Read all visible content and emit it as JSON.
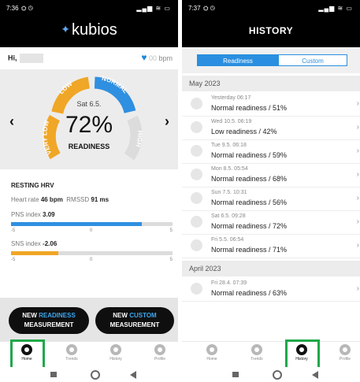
{
  "left": {
    "status_time": "7:36",
    "status_left_icons": "⛭ ◷",
    "status_right_icons": "▂▄▆ ≋ ▭",
    "app_name": "kubios",
    "greeting": "Hi,",
    "heart_rate_value": "00",
    "heart_rate_unit": "bpm",
    "gauge": {
      "date": "Sat 6.5.",
      "percent": "72%",
      "label": "READINESS",
      "readiness_value_percent": 72,
      "zones": [
        "VERY LOW",
        "LOW",
        "NORMAL",
        "HIGH"
      ],
      "zone_colors": [
        "#f0a626",
        "#f0a626",
        "#2f8fe0",
        "#dcdcdc"
      ],
      "prev_arrow": "‹",
      "next_arrow": "›"
    },
    "hrv": {
      "title": "RESTING HRV",
      "heart_rate_label": "Heart rate",
      "heart_rate": "46 bpm",
      "rmssd_label": "RMSSD",
      "rmssd": "91 ms",
      "pns_label": "PNS index",
      "pns_value": "3.09",
      "pns_numeric": 3.09,
      "pns_color": "#2f8fe0",
      "sns_label": "SNS index",
      "sns_value": "-2.06",
      "sns_numeric": -2.06,
      "sns_color": "#f0a626",
      "scale_min": "-5",
      "scale_mid": "0",
      "scale_max": "5"
    },
    "buttons": {
      "readiness_prefix": "NEW",
      "readiness_accent": "READINESS",
      "readiness_suffix": "MEASUREMENT",
      "custom_prefix": "NEW",
      "custom_accent": "CUSTOM",
      "custom_suffix": "MEASUREMENT",
      "accent_color": "#3ea8f0"
    },
    "nav": [
      {
        "label": "Home",
        "icon": "home-icon",
        "active": true
      },
      {
        "label": "Trends",
        "icon": "trends-icon",
        "active": false
      },
      {
        "label": "History",
        "icon": "history-icon",
        "active": false
      },
      {
        "label": "Profile",
        "icon": "profile-icon",
        "active": false
      }
    ]
  },
  "right": {
    "status_time": "7:37",
    "status_left_icons": "⛭ ◷",
    "status_right_icons": "▂▄▆ ≋ ▭",
    "title": "HISTORY",
    "tabs": [
      "Readiness",
      "Custom"
    ],
    "active_tab": "Readiness",
    "months": [
      {
        "name": "May 2023",
        "rows": [
          {
            "date": "Yesterday 06:17",
            "status": "Normal readiness / 51%"
          },
          {
            "date": "Wed 10.5. 06:19",
            "status": "Low readiness / 42%"
          },
          {
            "date": "Tue 9.5. 06:18",
            "status": "Normal readiness / 59%"
          },
          {
            "date": "Mon 8.5. 05:54",
            "status": "Normal readiness / 68%"
          },
          {
            "date": "Sun 7.5. 10:31",
            "status": "Normal readiness / 56%"
          },
          {
            "date": "Sat 6.5. 09:28",
            "status": "Normal readiness / 72%"
          },
          {
            "date": "Fri 5.5. 06:54",
            "status": "Normal readiness / 71%"
          }
        ]
      },
      {
        "name": "April 2023",
        "rows": [
          {
            "date": "Fri 28.4. 07:39",
            "status": "Normal readiness / 63%"
          }
        ]
      }
    ],
    "row_chevron": "›",
    "nav": [
      {
        "label": "Home",
        "icon": "home-icon",
        "active": false
      },
      {
        "label": "Trends",
        "icon": "trends-icon",
        "active": false
      },
      {
        "label": "History",
        "icon": "history-icon",
        "active": true
      },
      {
        "label": "Profile",
        "icon": "profile-icon",
        "active": false
      }
    ]
  },
  "highlight_color": "#20a84a"
}
